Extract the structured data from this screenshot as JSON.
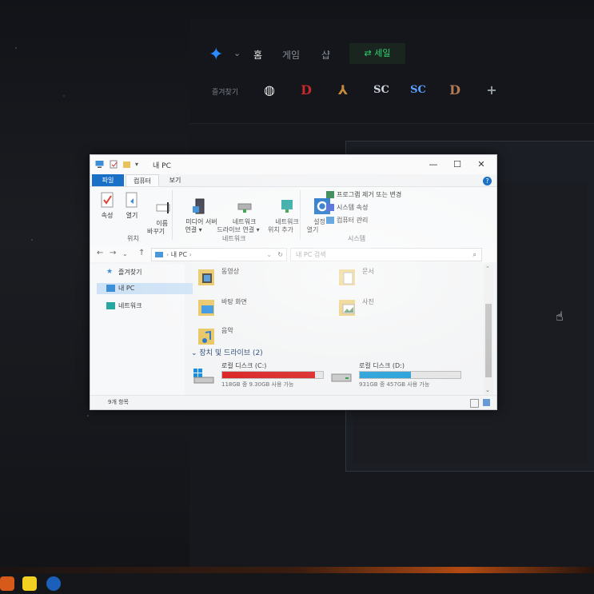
{
  "launcher": {
    "nav": [
      "홈",
      "게임",
      "샵"
    ],
    "shop_button": "세일",
    "favorites_label": "즐겨찾기",
    "games": [
      "overwatch",
      "diablo-3",
      "hots",
      "sc",
      "sc2",
      "diablo-2"
    ],
    "add": "+"
  },
  "window": {
    "title": "내 PC",
    "controls": [
      "—",
      "☐",
      "✕"
    ],
    "tabs": [
      "파일",
      "컴퓨터",
      "보기"
    ],
    "ribbon": {
      "properties": "속성",
      "open": "열기",
      "rename": "이름\n바꾸기",
      "media_server": "미디어 서버\n연결 ▾",
      "map_network_drive": "네트워크\n드라이브 연결 ▾",
      "add_network_location": "네트워크\n위치 추가",
      "open_settings": "설정\n열기",
      "uninstall_program": "프로그램 제거 또는 변경",
      "system_properties": "시스템 속성",
      "computer_management": "컴퓨터 관리",
      "groups": [
        "위치",
        "네트워크",
        "시스템"
      ]
    },
    "address": {
      "path": "내 PC",
      "search_placeholder": "내 PC 검색"
    },
    "navpane": [
      {
        "label": "즐겨찾기"
      },
      {
        "label": "내 PC"
      },
      {
        "label": "네트워크"
      }
    ],
    "folders": [
      "동영상",
      "문서",
      "바탕 화면",
      "사진",
      "음악"
    ],
    "drives_section": "장치 및 드라이브 (2)",
    "drives": [
      {
        "name": "로컬 디스크 (C:)",
        "info": "118GB 중 9.30GB 사용 가능",
        "used_fraction": 0.92,
        "color": "#da2626"
      },
      {
        "name": "로컬 디스크 (D:)",
        "info": "931GB 중 457GB 사용 가능",
        "used_fraction": 0.51,
        "color": "#26a0da"
      }
    ],
    "status": "9개 항목"
  }
}
